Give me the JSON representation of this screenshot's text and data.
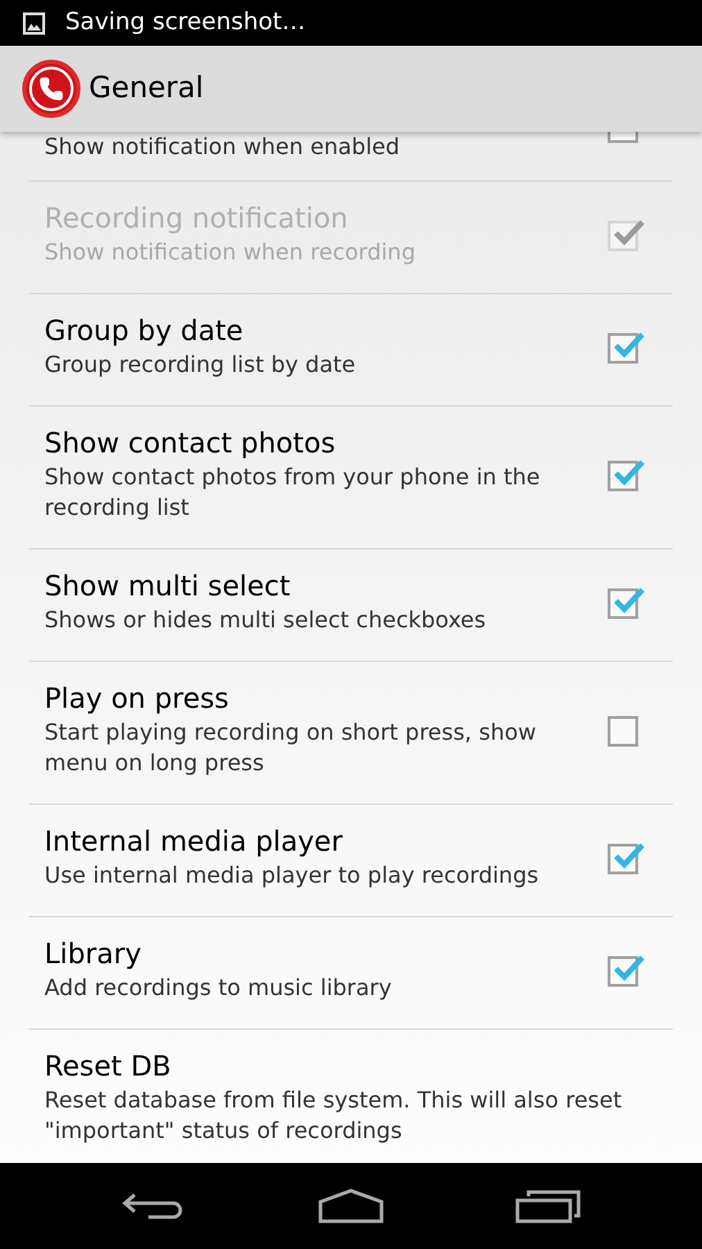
{
  "status_bar": {
    "text": "Saving screenshot…"
  },
  "action_bar": {
    "title": "General"
  },
  "settings": [
    {
      "kind": "checkbox",
      "summary": "Show notification when enabled",
      "checked": false,
      "disabled": false,
      "partial": true
    },
    {
      "kind": "checkbox",
      "title": "Recording notification",
      "summary": "Show notification when recording",
      "checked": true,
      "disabled": true
    },
    {
      "kind": "checkbox",
      "title": "Group by date",
      "summary": "Group recording list by date",
      "checked": true,
      "disabled": false
    },
    {
      "kind": "checkbox",
      "title": "Show contact photos",
      "summary": "Show contact photos from your phone in the recording list",
      "checked": true,
      "disabled": false
    },
    {
      "kind": "checkbox",
      "title": "Show multi select",
      "summary": "Shows or hides multi select checkboxes",
      "checked": true,
      "disabled": false
    },
    {
      "kind": "checkbox",
      "title": "Play on press",
      "summary": "Start playing recording on short press, show menu on long press",
      "checked": false,
      "disabled": false
    },
    {
      "kind": "checkbox",
      "title": "Internal media player",
      "summary": "Use internal media player to play recordings",
      "checked": true,
      "disabled": false
    },
    {
      "kind": "checkbox",
      "title": "Library",
      "summary": "Add recordings to music library",
      "checked": true,
      "disabled": false
    },
    {
      "kind": "action",
      "title": "Reset DB",
      "summary": "Reset database from file system. This will also reset \"important\" status of recordings",
      "disabled": false
    }
  ]
}
